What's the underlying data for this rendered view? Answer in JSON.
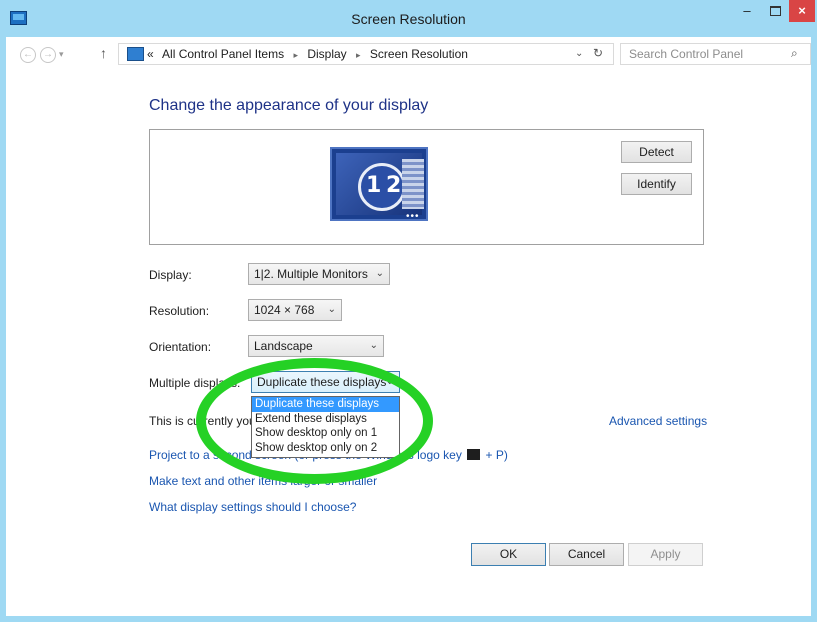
{
  "window": {
    "title": "Screen Resolution",
    "minimize": "–",
    "close": "×"
  },
  "address": {
    "prefix": "«",
    "crumbs": [
      "All Control Panel Items",
      "Display",
      "Screen Resolution"
    ],
    "crumb_separator": "▸",
    "dropdown_glyph": "⌄",
    "refresh_glyph": "↻",
    "up_glyph": "↑",
    "search_placeholder": "Search Control Panel",
    "search_glyph": "⌕"
  },
  "heading": "Change the appearance of your display",
  "preview": {
    "monitor_label_1": "1",
    "monitor_label_2": "2",
    "monitor_dots": "•••",
    "detect_button": "Detect",
    "identify_button": "Identify"
  },
  "form": {
    "display_label": "Display:",
    "display_value": "1|2. Multiple Monitors",
    "resolution_label": "Resolution:",
    "resolution_value": "1024 × 768",
    "orientation_label": "Orientation:",
    "orientation_value": "Landscape",
    "multiple_label": "Multiple displays:",
    "multiple_value": "Duplicate these displays",
    "arrow": "⌄"
  },
  "dropdown_options": [
    "Duplicate these displays",
    "Extend these displays",
    "Show desktop only on 1",
    "Show desktop only on 2"
  ],
  "status_text": "This is currently your main display.",
  "links": {
    "advanced": "Advanced settings",
    "project_prefix": "Project to a second screen (or press the Windows logo key",
    "project_suffix": "+ P)",
    "text_size": "Make text and other items larger or smaller",
    "help": "What display settings should I choose?"
  },
  "buttons": {
    "ok": "OK",
    "cancel": "Cancel",
    "apply": "Apply"
  },
  "colors": {
    "titlebar": "#9fd9f3",
    "link": "#1a56b0",
    "heading": "#1e3287",
    "selection": "#3399ff",
    "annotation_ring": "#25d125"
  }
}
